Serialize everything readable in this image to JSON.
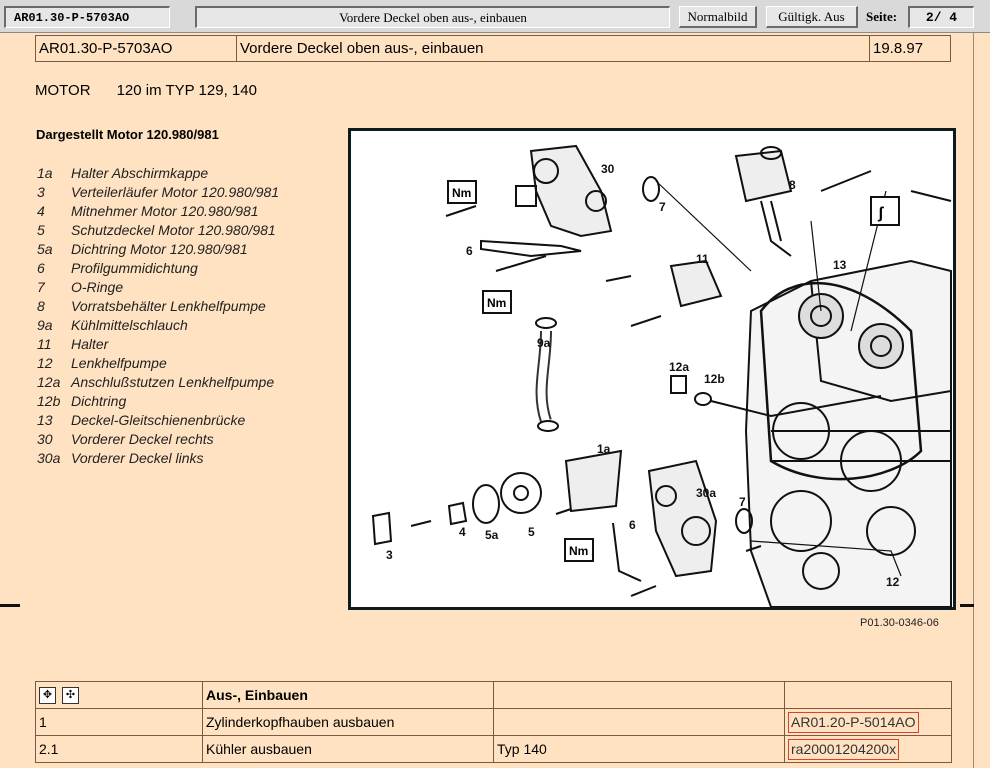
{
  "toolbar": {
    "doc_id": "AR01.30-P-5703AO",
    "title": "Vordere Deckel oben aus-, einbauen",
    "normalbild": "Normalbild",
    "gueltigkeit": "Gültigk. Aus",
    "seite_label": "Seite:",
    "page": "2/  4"
  },
  "header": {
    "code": "AR01.30-P-5703AO",
    "title": "Vordere Deckel oben aus-, einbauen",
    "date": "19.8.97"
  },
  "motor": {
    "label": "MOTOR",
    "value": "120 im TYP 129, 140"
  },
  "shown": "Dargestellt Motor 120.980/981",
  "legend": [
    {
      "k": "1a",
      "t": "Halter Abschirmkappe"
    },
    {
      "k": "3",
      "t": "Verteilerläufer Motor 120.980/981"
    },
    {
      "k": "4",
      "t": "Mitnehmer Motor 120.980/981"
    },
    {
      "k": "5",
      "t": "Schutzdeckel Motor 120.980/981"
    },
    {
      "k": "5a",
      "t": "Dichtring Motor 120.980/981"
    },
    {
      "k": "6",
      "t": "Profilgummidichtung"
    },
    {
      "k": "7",
      "t": "O-Ringe"
    },
    {
      "k": "8",
      "t": "Vorratsbehälter Lenkhelfpumpe"
    },
    {
      "k": "9a",
      "t": "Kühlmittelschlauch"
    },
    {
      "k": "11",
      "t": "Halter"
    },
    {
      "k": "12",
      "t": "Lenkhelfpumpe"
    },
    {
      "k": "12a",
      "t": "Anschlußstutzen Lenkhelfpumpe"
    },
    {
      "k": "12b",
      "t": "Dichtring"
    },
    {
      "k": "13",
      "t": "Deckel-Gleitschienenbrücke"
    },
    {
      "k": "30",
      "t": "Vorderer Deckel rechts"
    },
    {
      "k": "30a",
      "t": "Vorderer Deckel links"
    }
  ],
  "diagram": {
    "labels": {
      "l30": "30",
      "l7a": "7",
      "l8": "8",
      "l6a": "6",
      "l11": "11",
      "l13": "13",
      "l9a": "9a",
      "l12a": "12a",
      "l12b": "12b",
      "l1a": "1a",
      "l30a": "30a",
      "l7b": "7",
      "l6b": "6",
      "l3": "3",
      "l4": "4",
      "l5a": "5a",
      "l5": "5",
      "l12": "12"
    },
    "nm": "Nm",
    "caption": "P01.30-0346-06"
  },
  "table": {
    "header": "Aus-, Einbauen",
    "rows": [
      {
        "n": "1",
        "desc": "Zylinderkopfhauben ausbauen",
        "extra": "",
        "ref": "AR01.20-P-5014AO"
      },
      {
        "n": "2.1",
        "desc": "Kühler ausbauen",
        "extra": "Typ 140",
        "ref": "ra20001204200x"
      }
    ]
  }
}
